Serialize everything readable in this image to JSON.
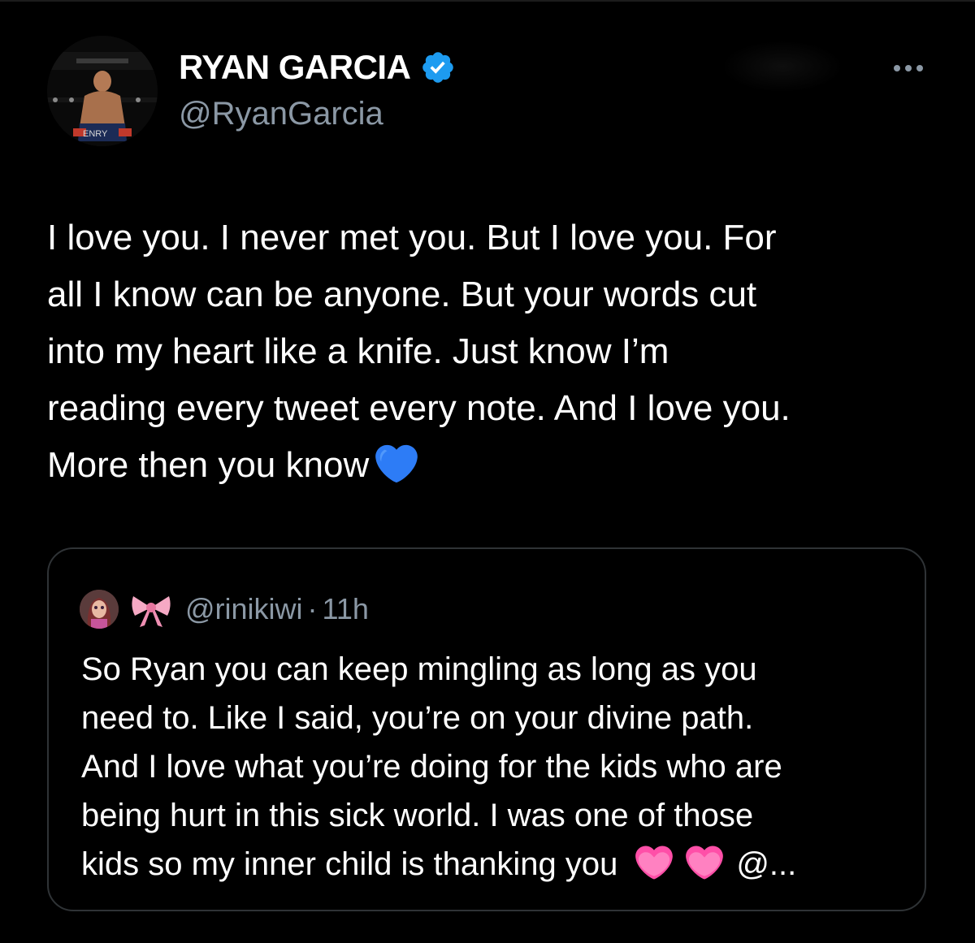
{
  "tweet": {
    "author": {
      "display_name": "RYAN GARCIA",
      "handle": "@RyanGarcia",
      "verified": true,
      "verified_color": "#1d9bf0",
      "avatar_text": "ENRY"
    },
    "text_lines": [
      "I love you. I never met you. But I love you. For",
      "all I know can be anyone. But your words cut",
      "into my heart like a knife. Just know I’m",
      "reading every tweet every note. And I love you.",
      "More then you know"
    ],
    "text_emoji": "blue-heart-icon"
  },
  "quoted_tweet": {
    "handle": "@rinikiwi",
    "separator": "·",
    "time": "11h",
    "name_emoji": "ribbon-icon",
    "text_lines": [
      "So Ryan you can keep mingling as long as you",
      "need to. Like I said, you’re on your divine path.",
      "And I love what you’re doing for the kids who are",
      "being hurt in this sick world. I was one of those",
      "kids so my inner child is thanking you"
    ],
    "trailing_emoji": [
      "growing-heart-icon",
      "growing-heart-icon"
    ],
    "truncated_mention": "@..."
  },
  "colors": {
    "background": "#000000",
    "text": "#ffffff",
    "secondary_text": "#8b98a5",
    "border": "#2f3336",
    "blue_heart": "#2d7cf6",
    "pink_heart": "#ff4fa8"
  }
}
